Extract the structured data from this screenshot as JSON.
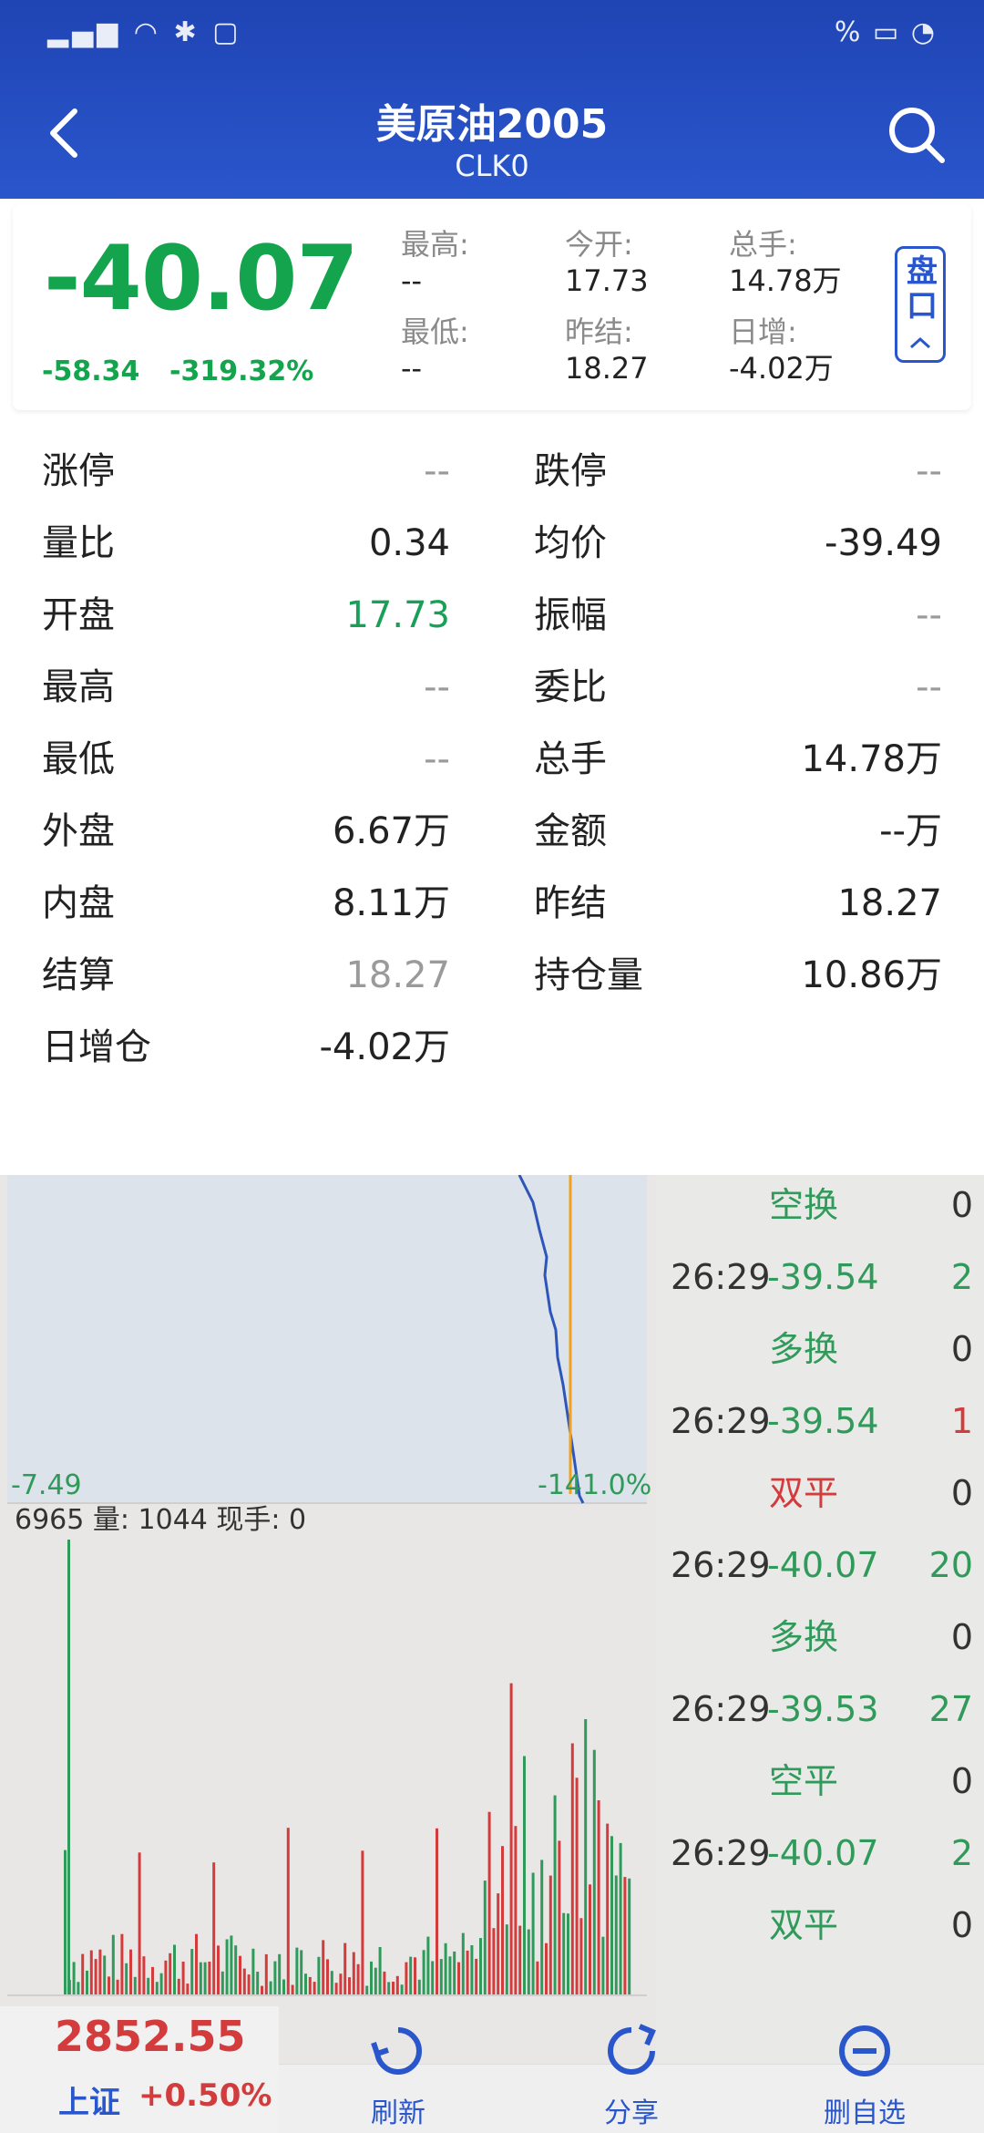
{
  "header": {
    "title": "美原油2005",
    "subtitle": "CLK0"
  },
  "quote": {
    "price": "-40.07",
    "change": "-58.34",
    "change_pct": "-319.32%",
    "cols": [
      {
        "label": "最高:",
        "value": "--"
      },
      {
        "label": "今开:",
        "value": "17.73"
      },
      {
        "label": "总手:",
        "value": "14.78万"
      },
      {
        "label": "最低:",
        "value": "--"
      },
      {
        "label": "昨结:",
        "value": "18.27"
      },
      {
        "label": "日增:",
        "value": "-4.02万"
      }
    ],
    "pankou_label": "盘口"
  },
  "stats": [
    {
      "k": "涨停",
      "v": "--"
    },
    {
      "k": "跌停",
      "v": "--"
    },
    {
      "k": "量比",
      "v": "0.34"
    },
    {
      "k": "均价",
      "v": "-39.49"
    },
    {
      "k": "开盘",
      "v": "17.73"
    },
    {
      "k": "振幅",
      "v": "--"
    },
    {
      "k": "最高",
      "v": "--"
    },
    {
      "k": "委比",
      "v": "--"
    },
    {
      "k": "最低",
      "v": "--"
    },
    {
      "k": "总手",
      "v": "14.78万"
    },
    {
      "k": "外盘",
      "v": "6.67万"
    },
    {
      "k": "金额",
      "v": "--万"
    },
    {
      "k": "内盘",
      "v": "8.11万"
    },
    {
      "k": "昨结",
      "v": "18.27"
    },
    {
      "k": "结算",
      "v": "18.27"
    },
    {
      "k": "持仓量",
      "v": "10.86万"
    },
    {
      "k": "日增仓",
      "v": "-4.02万"
    }
  ],
  "chart": {
    "left_label": "-7.49",
    "right_label": "-141.0%",
    "vol_info": "6965 量: 1044 现手: 0"
  },
  "trades": [
    {
      "type": "空换",
      "vol": "0"
    },
    {
      "time": "26:29",
      "price": "-39.54",
      "vol": "2"
    },
    {
      "type": "多换",
      "vol": "0"
    },
    {
      "time": "26:29",
      "price": "-39.54",
      "vol": "1"
    },
    {
      "type": "双平",
      "vol": "0"
    },
    {
      "time": "26:29",
      "price": "-40.07",
      "vol": "20"
    },
    {
      "type": "多换",
      "vol": "0"
    },
    {
      "time": "26:29",
      "price": "-39.53",
      "vol": "27"
    },
    {
      "type": "空平",
      "vol": "0"
    },
    {
      "time": "26:29",
      "price": "-40.07",
      "vol": "2"
    },
    {
      "type": "双平",
      "vol": "0"
    }
  ],
  "bottom": {
    "index_value": "2852.55",
    "index_name": "上证",
    "index_pct": "+0.50%",
    "refresh": "刷新",
    "share": "分享",
    "remove_fav": "删自选"
  },
  "colors": {
    "header_blue": "#2a56cc",
    "down_green": "#14a44d",
    "up_red": "#d23c3c"
  }
}
